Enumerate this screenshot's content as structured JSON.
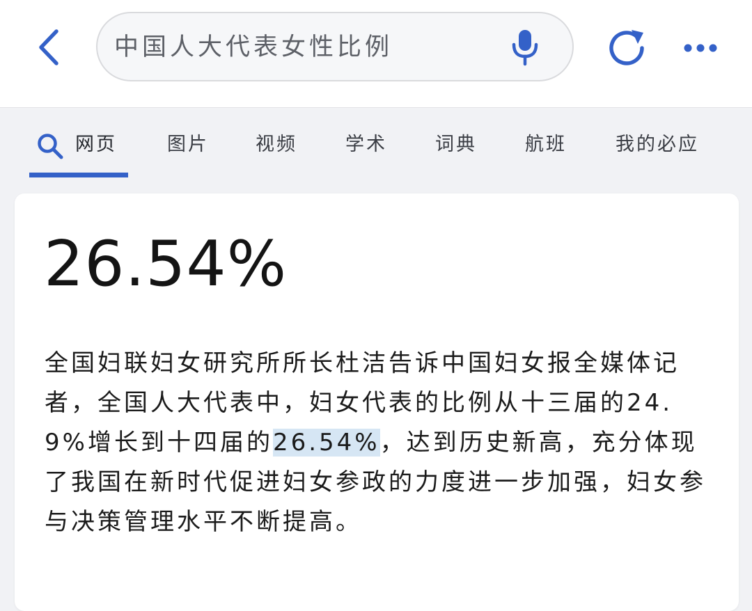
{
  "search": {
    "query": "中国人大代表女性比例"
  },
  "tabs": [
    {
      "label": "网页",
      "active": true
    },
    {
      "label": "图片"
    },
    {
      "label": "视频"
    },
    {
      "label": "学术"
    },
    {
      "label": "词典"
    },
    {
      "label": "航班"
    },
    {
      "label": "我的必应"
    }
  ],
  "colors": {
    "accent": "#3461c8",
    "highlight": "#d6e6f4"
  },
  "icons": {
    "back": "chevron-left-icon",
    "mic": "microphone-icon",
    "refresh": "refresh-icon",
    "more": "more-horizontal-icon",
    "tab_search": "search-icon"
  },
  "answer": {
    "value": "26.54%",
    "text_before": "全国妇联妇女研究所所长杜洁告诉中国妇女报全媒体记者，全国人大代表中，妇女代表的比例从十三届的24.9%增长到十四届的",
    "highlight": "26.54%",
    "text_after": "，达到历史新高，充分体现了我国在新时代促进妇女参政的力度进一步加强，妇女参与决策管理水平不断提高。"
  }
}
